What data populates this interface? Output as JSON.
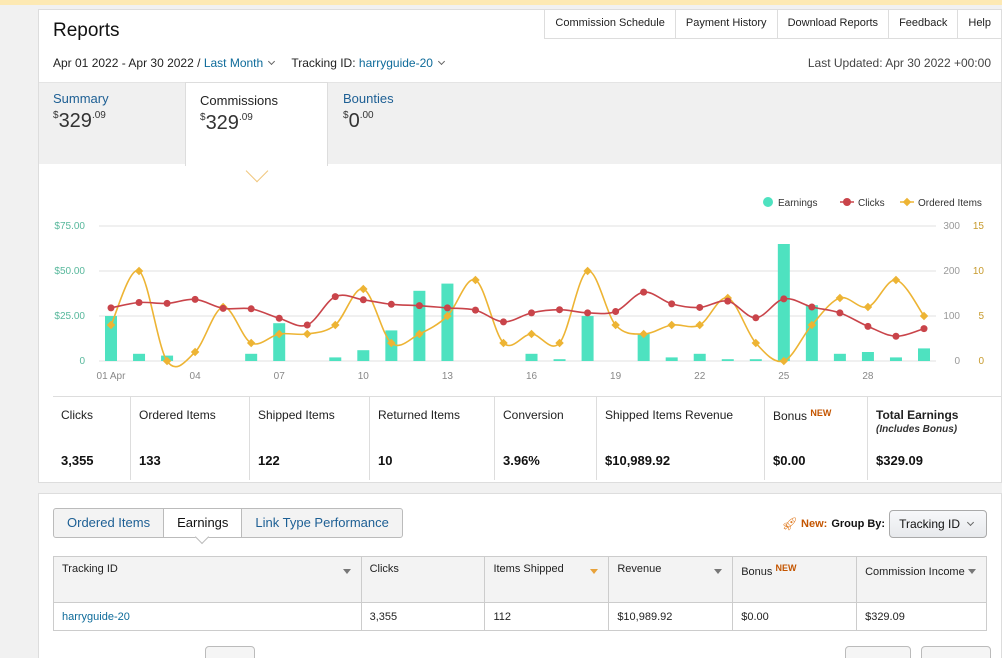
{
  "header": {
    "title": "Reports",
    "links": [
      "Commission Schedule",
      "Payment History",
      "Download Reports",
      "Feedback",
      "Help"
    ],
    "date_range": "Apr 01 2022 - Apr 30 2022",
    "date_sep": "/",
    "range_label": "Last Month",
    "tracking_label": "Tracking ID:",
    "tracking_value": "harryguide-20",
    "last_updated": "Last Updated: Apr 30 2022 +00:00"
  },
  "tabs": {
    "summary": {
      "label": "Summary",
      "currency": "$",
      "whole": "329",
      "cents": ".09"
    },
    "commissions": {
      "label": "Commissions",
      "currency": "$",
      "whole": "329",
      "cents": ".09"
    },
    "bounties": {
      "label": "Bounties",
      "currency": "$",
      "whole": "0",
      "cents": ".00"
    }
  },
  "colors": {
    "earnings": "#4ee2c0",
    "clicks": "#c9444a",
    "ordered": "#edb434",
    "accent": "#0e6b9a"
  },
  "chart_data": {
    "type": "bar",
    "x": [
      1,
      2,
      3,
      4,
      5,
      6,
      7,
      8,
      9,
      10,
      11,
      12,
      13,
      14,
      15,
      16,
      17,
      18,
      19,
      20,
      21,
      22,
      23,
      24,
      25,
      26,
      27,
      28,
      29,
      30
    ],
    "xticks": [
      "01 Apr",
      "04",
      "07",
      "10",
      "13",
      "16",
      "19",
      "22",
      "25",
      "28"
    ],
    "xtick_days": [
      1,
      4,
      7,
      10,
      13,
      16,
      19,
      22,
      25,
      28
    ],
    "legend": [
      "Earnings",
      "Clicks",
      "Ordered Items"
    ],
    "legend_position": "top-right",
    "y_left": {
      "ticks": [
        "$75.00",
        "$50.00",
        "$25.00",
        "0"
      ],
      "max": 75
    },
    "y_right1": {
      "ticks": [
        "300",
        "200",
        "100",
        "0"
      ],
      "max": 300
    },
    "y_right2": {
      "ticks": [
        "15",
        "10",
        "5",
        "0"
      ],
      "max": 15
    },
    "series": [
      {
        "name": "Earnings",
        "axis": "left",
        "type": "bar",
        "values": [
          25,
          4,
          3,
          0,
          0,
          4,
          21,
          0,
          2,
          6,
          17,
          39,
          43,
          0,
          0,
          4,
          1,
          25,
          0,
          15,
          2,
          4,
          1,
          1,
          65,
          31,
          4,
          5,
          2,
          7
        ]
      },
      {
        "name": "Clicks",
        "axis": "right1",
        "type": "line",
        "values": [
          118,
          130,
          128,
          137,
          117,
          116,
          95,
          80,
          143,
          136,
          126,
          123,
          118,
          113,
          87,
          107,
          114,
          107,
          110,
          153,
          127,
          119,
          133,
          96,
          138,
          120,
          107,
          77,
          55,
          72
        ]
      },
      {
        "name": "Ordered Items",
        "axis": "right2",
        "type": "line",
        "values": [
          4,
          10,
          0,
          1,
          6,
          2,
          3,
          3,
          4,
          8,
          2,
          3,
          5,
          9,
          2,
          3,
          2,
          10,
          4,
          3,
          4,
          4,
          7,
          2,
          0,
          4,
          7,
          6,
          9,
          5
        ]
      }
    ]
  },
  "metrics": [
    {
      "label": "Clicks",
      "value": "3,355"
    },
    {
      "label": "Ordered Items",
      "value": "133"
    },
    {
      "label": "Shipped Items",
      "value": "122"
    },
    {
      "label": "Returned Items",
      "value": "10"
    },
    {
      "label": "Conversion",
      "value": "3.96%"
    },
    {
      "label": "Shipped Items Revenue",
      "value": "$10,989.92"
    },
    {
      "label": "Bonus",
      "new": "NEW",
      "value": "$0.00"
    },
    {
      "label": "Total Earnings",
      "sub": "(Includes Bonus)",
      "value": "$329.09"
    }
  ],
  "subtabs": [
    "Ordered Items",
    "Earnings",
    "Link Type Performance"
  ],
  "groupby": {
    "new": "New:",
    "label": "Group By:",
    "value": "Tracking ID"
  },
  "table": {
    "headers": [
      "Tracking ID",
      "Clicks",
      "Items Shipped",
      "Revenue",
      "Bonus",
      "Commission Income"
    ],
    "bonus_new": "NEW",
    "row": [
      "harryguide-20",
      "3,355",
      "112",
      "$10,989.92",
      "$0.00",
      "$329.09"
    ]
  }
}
